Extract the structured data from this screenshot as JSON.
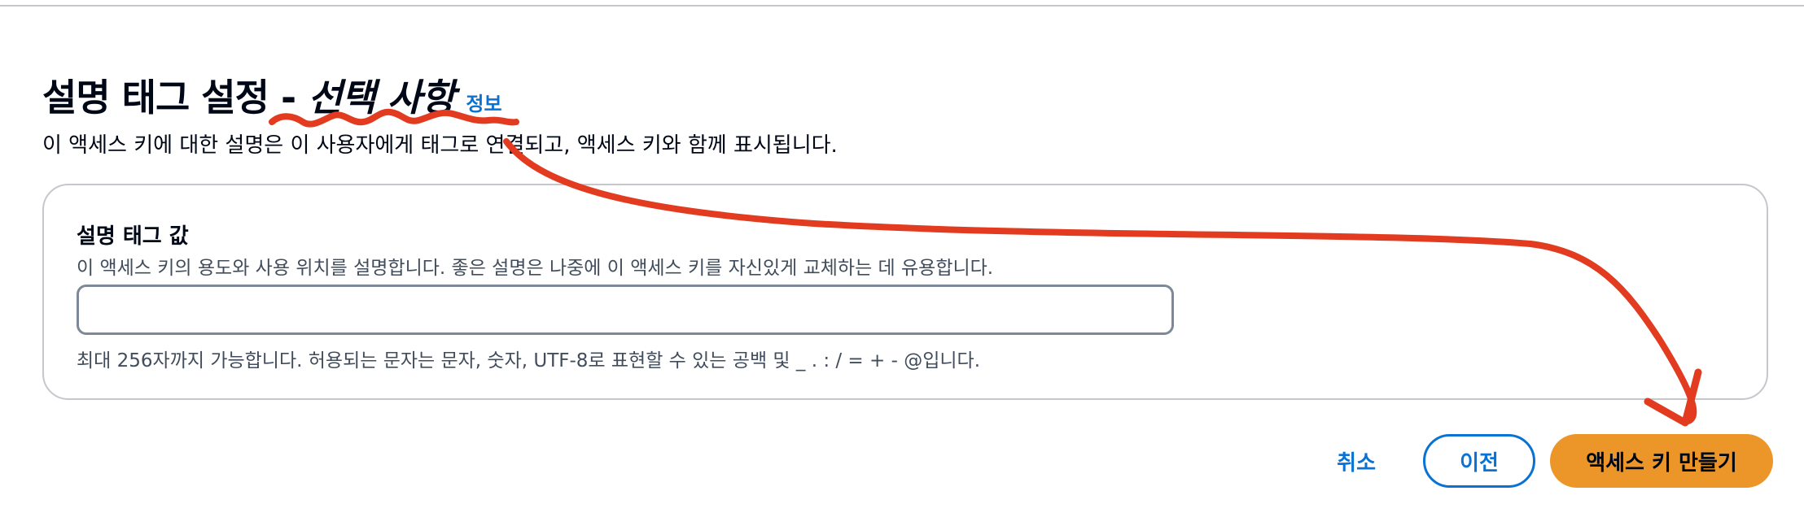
{
  "header": {
    "title": "설명 태그 설정 - ",
    "title_optional": "선택 사항",
    "info_link": "정보",
    "description": "이 액세스 키에 대한 설명은 이 사용자에게 태그로 연결되고, 액세스 키와 함께 표시됩니다."
  },
  "form": {
    "label": "설명 태그 값",
    "description": "이 액세스 키의 용도와 사용 위치를 설명합니다. 좋은 설명은 나중에 이 액세스 키를 자신있게 교체하는 데 유용합니다.",
    "value": "",
    "constraint": "최대 256자까지 가능합니다. 허용되는 문자는 문자, 숫자, UTF-8로 표현할 수 있는 공백 및 _ . : / = + - @입니다."
  },
  "actions": {
    "cancel_label": "취소",
    "previous_label": "이전",
    "create_label": "액세스 키 만들기"
  },
  "colors": {
    "accent_blue": "#0972d3",
    "primary_orange": "#ec9629",
    "annotation_red": "#e23b1f"
  }
}
